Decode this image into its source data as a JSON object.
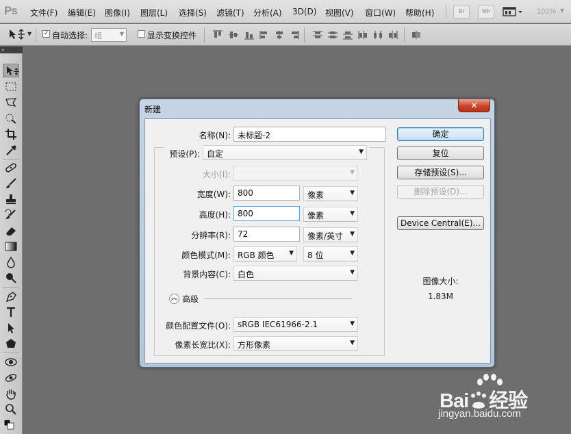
{
  "app": {
    "logo": "Ps",
    "zoom": "100%"
  },
  "menu": [
    "文件(F)",
    "编辑(E)",
    "图像(I)",
    "图层(L)",
    "选择(S)",
    "滤镜(T)",
    "分析(A)",
    "3D(D)",
    "视图(V)",
    "窗口(W)",
    "帮助(H)"
  ],
  "menubar_buttons": {
    "bridge": "Br",
    "mini_bridge": "Mb"
  },
  "options_bar": {
    "auto_select_label": "自动选择:",
    "auto_select_checked": true,
    "auto_select_target": "组",
    "show_transform_label": "显示变换控件",
    "show_transform_checked": false
  },
  "toolbar": {
    "tools": [
      "move",
      "marquee",
      "lasso",
      "quick-select",
      "crop",
      "eyedropper",
      "healing",
      "brush",
      "clone-stamp",
      "history-brush",
      "eraser",
      "gradient",
      "blur",
      "dodge",
      "pen",
      "type",
      "path-select",
      "shape",
      "3d-rotate",
      "3d-orbit",
      "hand",
      "zoom"
    ]
  },
  "dialog": {
    "title": "新建",
    "close": "✕",
    "name_label": "名称(N):",
    "name_value": "未标题-2",
    "preset_label": "预设(P):",
    "preset_value": "自定",
    "size_label": "大小(I):",
    "size_value": "",
    "width_label": "宽度(W):",
    "width_value": "800",
    "width_unit": "像素",
    "height_label": "高度(H):",
    "height_value": "800",
    "height_unit": "像素",
    "resolution_label": "分辨率(R):",
    "resolution_value": "72",
    "resolution_unit": "像素/英寸",
    "color_mode_label": "颜色模式(M):",
    "color_mode_value": "RGB 颜色",
    "bit_depth_value": "8 位",
    "background_label": "背景内容(C):",
    "background_value": "白色",
    "advanced_label": "高级",
    "color_profile_label": "颜色配置文件(O):",
    "color_profile_value": "sRGB IEC61966-2.1",
    "pixel_aspect_label": "像素长宽比(X):",
    "pixel_aspect_value": "方形像素",
    "buttons": {
      "ok": "确定",
      "reset": "复位",
      "save_preset": "存储预设(S)...",
      "delete_preset": "删除预设(D)...",
      "device_central": "Device Central(E)..."
    },
    "image_size_label": "图像大小:",
    "image_size_value": "1.83M"
  },
  "watermark": {
    "brand": "Bai",
    "brand2": "经验",
    "url": "jingyan.baidu.com"
  }
}
